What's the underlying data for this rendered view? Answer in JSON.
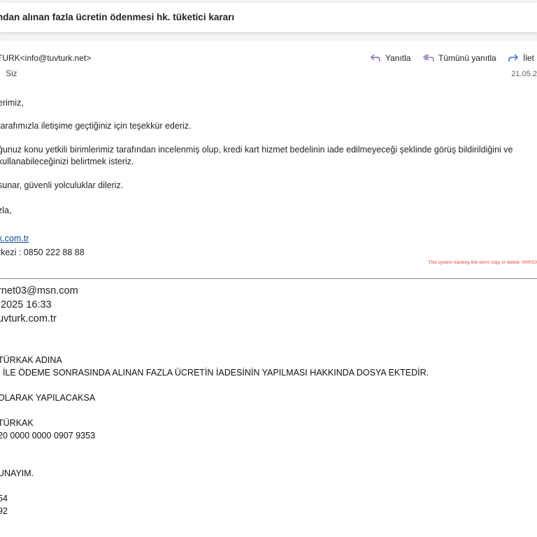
{
  "subject": "ndan alınan fazla ücretin ödenmesi hk. tüketici kararı",
  "sender": "TURK<info@tuvturk.net>",
  "to_prefix": ":",
  "to": "Siz",
  "actions": {
    "reply": "Yanıtla",
    "reply_all": "Tümünü yanıtla",
    "forward": "İlet"
  },
  "date": "21.05.2",
  "body": {
    "greeting": "erimiz,",
    "p1": "tarafımızla iletişime geçtiğiniz için teşekkür ederiz.",
    "p2a": "ğunuz konu yetkili birimlerimiz tarafından incelenmiş olup,  kredi kart hizmet bedelinin iade edilmeyeceği şeklinde görüş bildirildiğini ve",
    "p2b": "kullanabileceğinizi belirtmek isteriz.",
    "p3": "sunar, güvenli yolculuklar dileriz.",
    "closing": "zla,",
    "website": "k.com.tr",
    "call_center": "rkezi : 0850 222 88 88"
  },
  "tracking_notice": "This system tracking link won't copy or delete: #00010",
  "quoted": {
    "from": "rnet03@msn.com",
    "date": ".2025 16:33",
    "to": "uvturk.com.tr",
    "lines": [
      "TÜRKAK ADINA",
      "I İLE ÖDEME SONRASINDA ALINAN FAZLA ÜCRETİN İADESİNİN YAPILMASI HAKKINDA DOSYA EKTEDİR.",
      "OLARAK YAPILACAKSA",
      "TÜRKAK",
      "20 0000 0000 0907 9353",
      "UNAYIM.",
      "54",
      "92"
    ]
  },
  "colors": {
    "reply_icon": "#8764b8",
    "forward_icon": "#2f6fd6",
    "link": "#0f4c9c",
    "tracking": "#e53935"
  }
}
